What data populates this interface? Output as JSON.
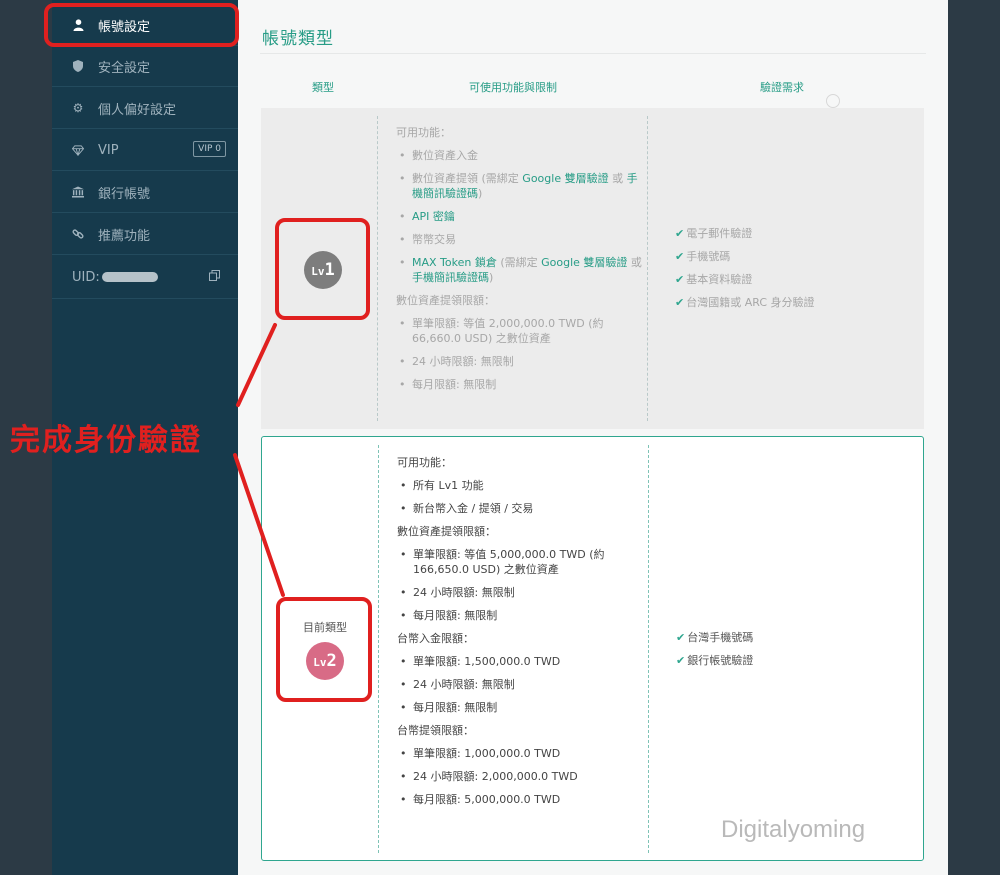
{
  "sidebar": {
    "items": [
      {
        "label": "帳號設定",
        "icon": "user-icon",
        "active": true
      },
      {
        "label": "安全設定",
        "icon": "shield-icon"
      },
      {
        "label": "個人偏好設定",
        "icon": "gear-icon"
      },
      {
        "label": "VIP",
        "icon": "diamond-icon",
        "badge": "VIP 0"
      },
      {
        "label": "銀行帳號",
        "icon": "bank-icon"
      },
      {
        "label": "推薦功能",
        "icon": "link-icon"
      }
    ],
    "uid_label": "UID:"
  },
  "page": {
    "title": "帳號類型",
    "columns": {
      "type": "類型",
      "features": "可使用功能與限制",
      "requirements": "驗證需求"
    }
  },
  "levels": [
    {
      "badge": "Lv1",
      "features_title": "可用功能：",
      "features": [
        {
          "text": "數位資產入金"
        },
        {
          "pre": "數位資產提領 (需綁定 ",
          "link1": "Google 雙層驗證",
          "mid": " 或 ",
          "link2": "手機簡訊驗證碼",
          "post": ")"
        },
        {
          "link": "API 密鑰"
        },
        {
          "text": "幣幣交易"
        },
        {
          "link": "MAX Token 鎖倉",
          "pre": " (需綁定 ",
          "link1": "Google 雙層驗證",
          "mid": " 或 ",
          "link2": "手機簡訊驗證碼",
          "post": ")"
        }
      ],
      "limits_title": "數位資產提領限額：",
      "limits": [
        {
          "label": "單筆限額: ",
          "value": "等值 2,000,000.0 TWD (約 66,660.0 USD) 之數位資產"
        },
        {
          "label": "24 小時限額: ",
          "value": "無限制"
        },
        {
          "label": "每月限額: ",
          "value": "無限制"
        }
      ],
      "requirements": [
        "電子郵件驗證",
        "手機號碼",
        "基本資料驗證",
        "台灣國籍或 ARC 身分驗證"
      ]
    },
    {
      "badge": "Lv2",
      "current_label": "目前類型",
      "features_title": "可用功能：",
      "features": [
        "所有 Lv1 功能",
        "新台幣入金 / 提領 / 交易"
      ],
      "crypto_title": "數位資產提領限額：",
      "crypto": [
        {
          "label": "單筆限額: ",
          "value": "等值 5,000,000.0 TWD (約 166,650.0 USD) 之數位資產"
        },
        {
          "label": "24 小時限額: ",
          "value": "無限制"
        },
        {
          "label": "每月限額: ",
          "value": "無限制"
        }
      ],
      "deposit_title": "台幣入金限額：",
      "deposit": [
        {
          "label": "單筆限額: ",
          "value": "1,500,000.0 TWD"
        },
        {
          "label": "24 小時限額: ",
          "value": "無限制"
        },
        {
          "label": "每月限額: ",
          "value": "無限制"
        }
      ],
      "withdraw_title": "台幣提領限額：",
      "withdraw": [
        {
          "label": "單筆限額: ",
          "value": "1,000,000.0 TWD"
        },
        {
          "label": "24 小時限額: ",
          "value": "2,000,000.0 TWD"
        },
        {
          "label": "每月限額: ",
          "value": "5,000,000.0 TWD"
        }
      ],
      "requirements": [
        "台灣手機號碼",
        "銀行帳號驗證"
      ]
    }
  ],
  "annotation": "完成身份驗證",
  "watermark": "Digitalyoming",
  "colors": {
    "accent": "#279c86",
    "annotation": "#e0201f",
    "sidebar": "#163a4c"
  }
}
